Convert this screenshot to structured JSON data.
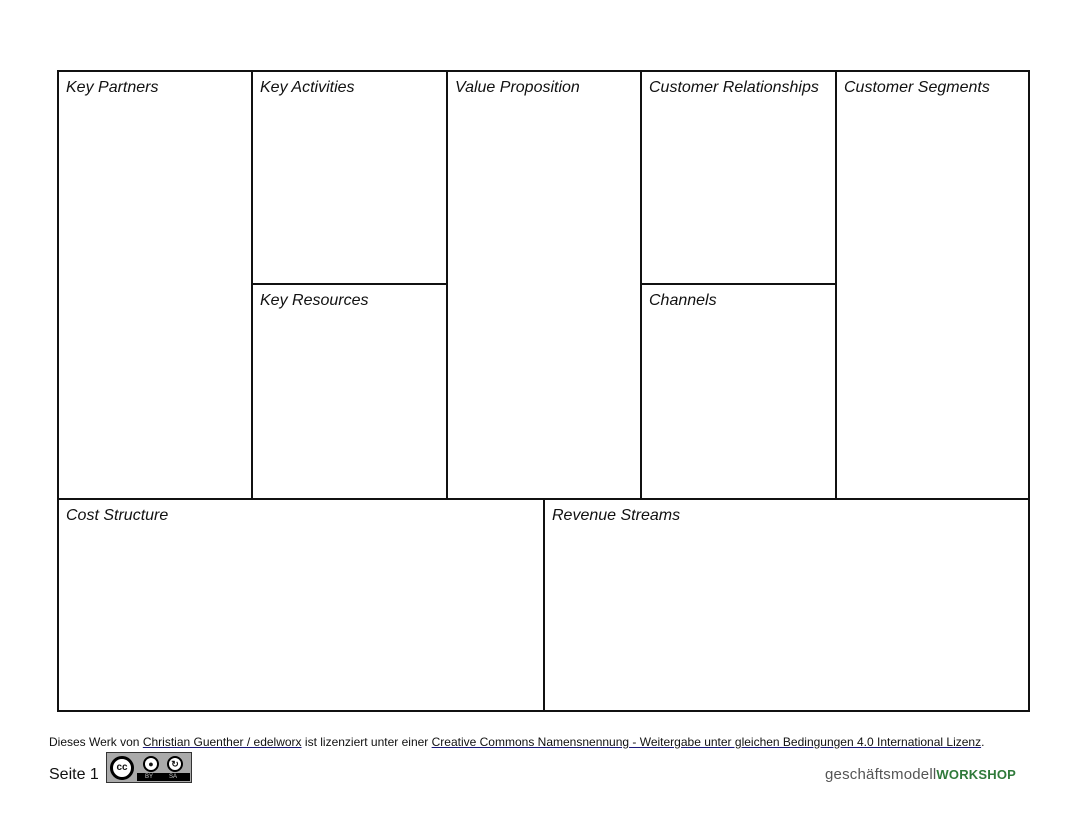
{
  "canvas": {
    "key_partners": "Key Partners",
    "key_activities": "Key Activities",
    "key_resources": "Key Resources",
    "value_proposition": "Value Proposition",
    "customer_relationships": "Customer Relationships",
    "channels": "Channels",
    "customer_segments": "Customer Segments",
    "cost_structure": "Cost Structure",
    "revenue_streams": "Revenue Streams"
  },
  "footer": {
    "prefix": "Dieses Werk von ",
    "author_link": "Christian Guenther / edelworx",
    "middle": " ist lizenziert unter einer ",
    "license_link": "Creative Commons Namensnennung - Weitergabe unter gleichen Bedingungen 4.0 International Lizenz",
    "suffix": ".",
    "page_label": "Seite 1",
    "cc_badge": {
      "cc": "cc",
      "by": "BY",
      "sa": "SA"
    },
    "logo_light": "geschäftsmodell",
    "logo_bold": "WORKSHOP"
  }
}
